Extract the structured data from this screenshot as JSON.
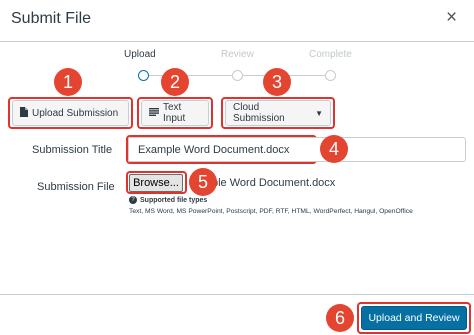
{
  "dialog": {
    "title": "Submit File",
    "close_icon": "×"
  },
  "steps": [
    {
      "label": "Upload",
      "state": "active"
    },
    {
      "label": "Review",
      "state": "inactive"
    },
    {
      "label": "Complete",
      "state": "inactive"
    }
  ],
  "tabs": {
    "upload_submission": {
      "label": "Upload Submission",
      "icon": "file-icon"
    },
    "text_input": {
      "label": "Text Input",
      "icon": "lines-icon"
    },
    "cloud_submission": {
      "label": "Cloud Submission",
      "icon": "caret-down-icon"
    }
  },
  "form": {
    "submission_title_label": "Submission Title",
    "submission_title_value": "Example Word Document.docx",
    "submission_file_label": "Submission File",
    "browse_label": "Browse...",
    "file_name": "ple Word Document.docx",
    "supported_label": "Supported file types",
    "supported_ghost": "",
    "file_types": "Text, MS Word, MS PowerPoint, Postscript, PDF, RTF, HTML, WordPerfect, Hangul, OpenOffice"
  },
  "footer": {
    "submit_label": "Upload and Review"
  },
  "callouts": [
    "1",
    "2",
    "3",
    "4",
    "5",
    "6"
  ],
  "colors": {
    "primary": "#0770a3",
    "callout": "#e34531",
    "highlight": "#e0322f",
    "text": "#2d3b45"
  }
}
